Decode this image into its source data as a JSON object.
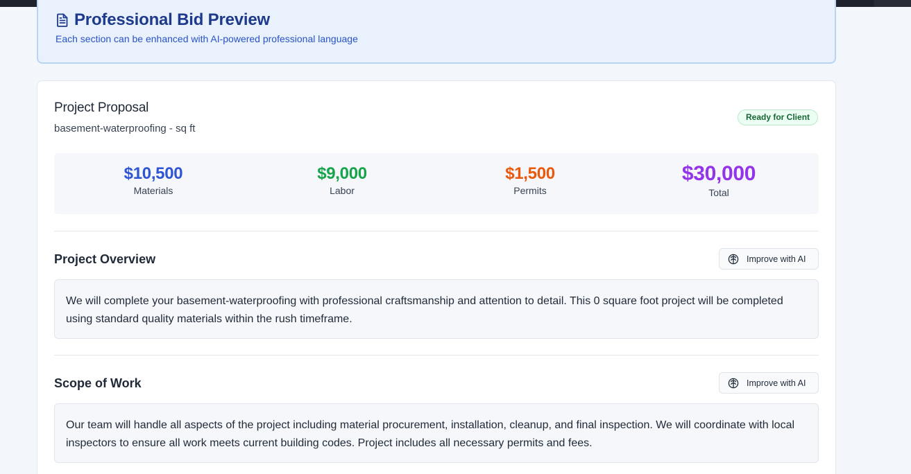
{
  "banner": {
    "title": "Professional Bid Preview",
    "subtitle": "Each section can be enhanced with AI-powered professional language",
    "icon": "document-icon"
  },
  "proposal": {
    "title": "Project Proposal",
    "subtitle": "basement-waterproofing - sq ft",
    "status_badge": "Ready for Client"
  },
  "stats": [
    {
      "value": "$10,500",
      "label": "Materials",
      "color": "#2f55d4"
    },
    {
      "value": "$9,000",
      "label": "Labor",
      "color": "#16a34a"
    },
    {
      "value": "$1,500",
      "label": "Permits",
      "color": "#ea580c"
    },
    {
      "value": "$30,000",
      "label": "Total",
      "color": "#9333ea"
    }
  ],
  "sections": [
    {
      "title": "Project Overview",
      "button_label": "Improve with AI",
      "text": "We will complete your basement-waterproofing with professional craftsmanship and attention to detail. This 0 square foot project will be completed using standard quality materials within the rush timeframe."
    },
    {
      "title": "Scope of Work",
      "button_label": "Improve with AI",
      "text": "Our team will handle all aspects of the project including material procurement, installation, cleanup, and final inspection. We will coordinate with local inspectors to ensure all work meets current building codes. Project includes all necessary permits and fees."
    }
  ],
  "colors": {
    "accent_blue": "#1e3a8a",
    "badge_green": "#166534"
  }
}
